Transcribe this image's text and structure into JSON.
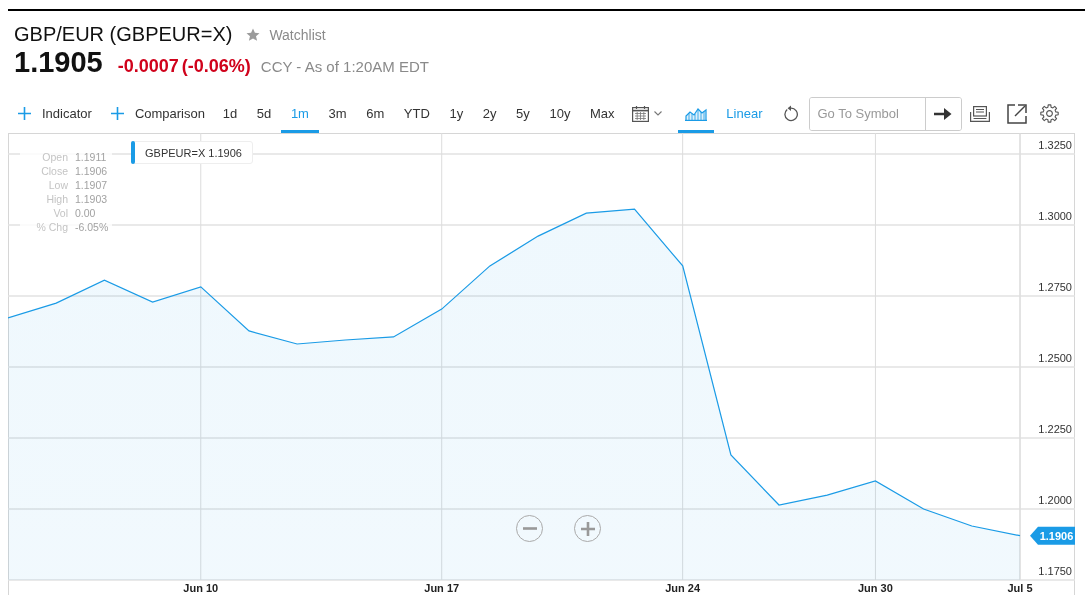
{
  "quote": {
    "title": "GBP/EUR (GBPEUR=X)",
    "watchlist_label": "Watchlist",
    "price": "1.1905",
    "change": "-0.0007",
    "change_percent": "(-0.06%)",
    "negative": true,
    "market_note": "CCY - As of 1:20AM EDT"
  },
  "toolbar": {
    "add_buttons": [
      {
        "label": "Indicator"
      },
      {
        "label": "Comparison"
      }
    ],
    "ranges": [
      {
        "label": "1d",
        "selected": false
      },
      {
        "label": "5d",
        "selected": false
      },
      {
        "label": "1m",
        "selected": true
      },
      {
        "label": "3m",
        "selected": false
      },
      {
        "label": "6m",
        "selected": false
      },
      {
        "label": "YTD",
        "selected": false
      },
      {
        "label": "1y",
        "selected": false
      },
      {
        "label": "2y",
        "selected": false
      },
      {
        "label": "5y",
        "selected": false
      },
      {
        "label": "10y",
        "selected": false
      },
      {
        "label": "Max",
        "selected": false
      }
    ],
    "chart_type_button": {
      "selected": true
    },
    "scale_label": "Linear",
    "symbol_search": {
      "placeholder": "Go To Symbol"
    }
  },
  "chart": {
    "legend_value": "1.1906",
    "price_tag": "1.1906",
    "ohlc": [
      {
        "label": "Open",
        "value": "1.1911"
      },
      {
        "label": "Close",
        "value": "1.1906"
      },
      {
        "label": "Low",
        "value": "1.1907"
      },
      {
        "label": "High",
        "value": "1.1903"
      },
      {
        "label": "Vol",
        "value": "0.00"
      },
      {
        "label": "% Chg",
        "value": "-6.05%"
      }
    ],
    "chart_data": {
      "type": "area",
      "categories": [
        null,
        null,
        null,
        null,
        "Jun 10",
        null,
        null,
        null,
        null,
        "Jun 17",
        null,
        null,
        null,
        null,
        "Jun 24",
        null,
        null,
        null,
        "Jun 30",
        null,
        null,
        "Jul 5"
      ],
      "series": [
        {
          "name": "GBPEUR=X",
          "color": "#1a9be6",
          "values": [
            1.2673,
            1.2725,
            1.2806,
            1.2729,
            1.2782,
            1.2627,
            1.2581,
            1.2595,
            1.2606,
            1.2704,
            1.2856,
            1.2961,
            1.3042,
            1.3056,
            1.2856,
            1.219,
            1.2014,
            1.2049,
            1.2099,
            1.2,
            1.194,
            1.1906
          ]
        }
      ],
      "ylim": [
        1.175,
        1.3324
      ],
      "yticks": [
        {
          "value": 1.175,
          "label": "1.1750"
        },
        {
          "value": 1.2,
          "label": "1.2000"
        },
        {
          "value": 1.225,
          "label": "1.2250"
        },
        {
          "value": 1.25,
          "label": "1.2500"
        },
        {
          "value": 1.275,
          "label": "1.2750"
        },
        {
          "value": 1.3,
          "label": "1.3000"
        },
        {
          "value": 1.325,
          "label": "1.3250"
        }
      ],
      "grid": true
    }
  }
}
